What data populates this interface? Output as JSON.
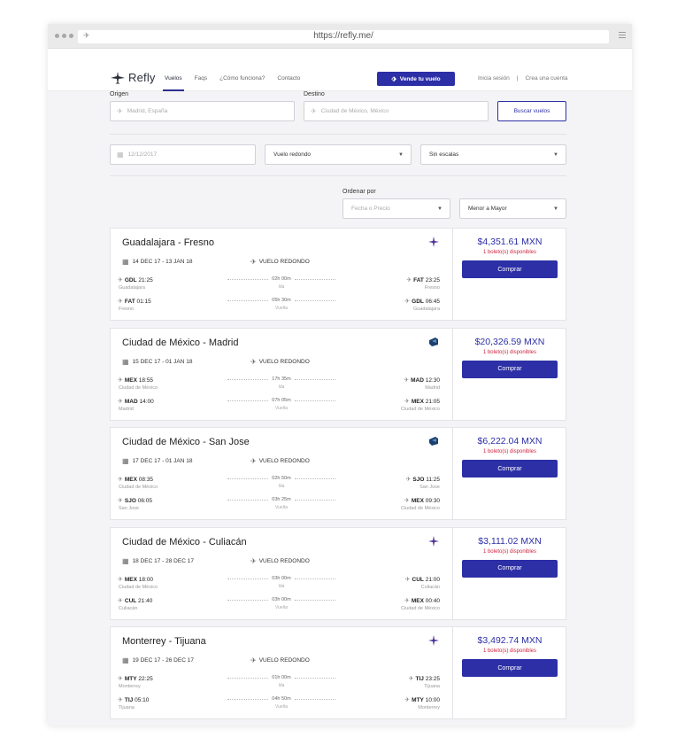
{
  "browser": {
    "url": "https://refly.me/"
  },
  "nav": {
    "logo": "Refly",
    "links": [
      {
        "label": "Vuelos",
        "active": true
      },
      {
        "label": "Faqs",
        "active": false
      },
      {
        "label": "¿Cómo funciona?",
        "active": false
      },
      {
        "label": "Contacto",
        "active": false
      }
    ],
    "sell_button": "Vende tu vuelo",
    "login": "Inicia sesión",
    "separator": "|",
    "signup": "Crea una cuenta"
  },
  "search": {
    "origin_label": "Origen",
    "origin_placeholder": "Madrid, España",
    "destination_label": "Destino",
    "destination_placeholder": "Ciudad de México, México",
    "search_button": "Buscar vuelos",
    "date_placeholder": "12/12/2017",
    "trip_type": "Vuelo redondo",
    "stops": "Sin escalas",
    "sort_label": "Ordenar por",
    "sort_by": "Fecha o Precio",
    "sort_order": "Menor a Mayor"
  },
  "colors": {
    "accent": "#2c2fa6",
    "availability": "#d0243f"
  },
  "results": [
    {
      "route": "Guadalajara - Fresno",
      "airline_icon": "volaris-icon",
      "dates": "14 DEC 17 - 13 JAN 18",
      "trip": "VUELO REDONDO",
      "price": "$4,351.61 MXN",
      "availability": "1 boleto(s) disponibles",
      "buy": "Comprar",
      "legs": [
        {
          "dep_code": "GDL",
          "dep_time": "21:25",
          "dep_city": "Guadalajara",
          "duration": "02h 00m",
          "dir": "Ida",
          "arr_code": "FAT",
          "arr_time": "23:25",
          "arr_city": "Fresno"
        },
        {
          "dep_code": "FAT",
          "dep_time": "01:15",
          "dep_city": "Fresno",
          "duration": "05h 30m",
          "dir": "Vuelta",
          "arr_code": "GDL",
          "arr_time": "06:45",
          "arr_city": "Guadalajara"
        }
      ]
    },
    {
      "route": "Ciudad de México - Madrid",
      "airline_icon": "aeromexico-icon",
      "dates": "15 DEC 17 - 01 JAN 18",
      "trip": "VUELO REDONDO",
      "price": "$20,326.59 MXN",
      "availability": "1 boleto(s) disponibles",
      "buy": "Comprar",
      "legs": [
        {
          "dep_code": "MEX",
          "dep_time": "18:55",
          "dep_city": "Ciudad de México",
          "duration": "17h 35m",
          "dir": "Ida",
          "arr_code": "MAD",
          "arr_time": "12:30",
          "arr_city": "Madrid"
        },
        {
          "dep_code": "MAD",
          "dep_time": "14:00",
          "dep_city": "Madrid",
          "duration": "07h 05m",
          "dir": "Vuelta",
          "arr_code": "MEX",
          "arr_time": "21:05",
          "arr_city": "Ciudad de México"
        }
      ]
    },
    {
      "route": "Ciudad de México - San Jose",
      "airline_icon": "aeromexico-icon",
      "dates": "17 DEC 17 - 01 JAN 18",
      "trip": "VUELO REDONDO",
      "price": "$6,222.04 MXN",
      "availability": "1 boleto(s) disponibles",
      "buy": "Comprar",
      "legs": [
        {
          "dep_code": "MEX",
          "dep_time": "08:35",
          "dep_city": "Ciudad de México",
          "duration": "02h 50m",
          "dir": "Ida",
          "arr_code": "SJO",
          "arr_time": "11:25",
          "arr_city": "San Jose"
        },
        {
          "dep_code": "SJO",
          "dep_time": "06:05",
          "dep_city": "San Jose",
          "duration": "03h 25m",
          "dir": "Vuelta",
          "arr_code": "MEX",
          "arr_time": "09:30",
          "arr_city": "Ciudad de México"
        }
      ]
    },
    {
      "route": "Ciudad de México - Culiacán",
      "airline_icon": "volaris-icon",
      "dates": "18 DEC 17 - 28 DEC 17",
      "trip": "VUELO REDONDO",
      "price": "$3,111.02 MXN",
      "availability": "1 boleto(s) disponibles",
      "buy": "Comprar",
      "legs": [
        {
          "dep_code": "MEX",
          "dep_time": "18:00",
          "dep_city": "Ciudad de México",
          "duration": "03h 00m",
          "dir": "Ida",
          "arr_code": "CUL",
          "arr_time": "21:00",
          "arr_city": "Culiacán"
        },
        {
          "dep_code": "CUL",
          "dep_time": "21:40",
          "dep_city": "Culiacán",
          "duration": "03h 00m",
          "dir": "Vuelta",
          "arr_code": "MEX",
          "arr_time": "00:40",
          "arr_city": "Ciudad de México"
        }
      ]
    },
    {
      "route": "Monterrey - Tijuana",
      "airline_icon": "volaris-icon",
      "dates": "19 DEC 17 - 26 DEC 17",
      "trip": "VUELO REDONDO",
      "price": "$3,492.74 MXN",
      "availability": "1 boleto(s) disponibles",
      "buy": "Comprar",
      "legs": [
        {
          "dep_code": "MTY",
          "dep_time": "22:25",
          "dep_city": "Monterrey",
          "duration": "01h 00m",
          "dir": "Ida",
          "arr_code": "TIJ",
          "arr_time": "23:25",
          "arr_city": "Tijuana"
        },
        {
          "dep_code": "TIJ",
          "dep_time": "05:10",
          "dep_city": "Tijuana",
          "duration": "04h 50m",
          "dir": "Vuelta",
          "arr_code": "MTY",
          "arr_time": "10:00",
          "arr_city": "Monterrey"
        }
      ]
    }
  ]
}
